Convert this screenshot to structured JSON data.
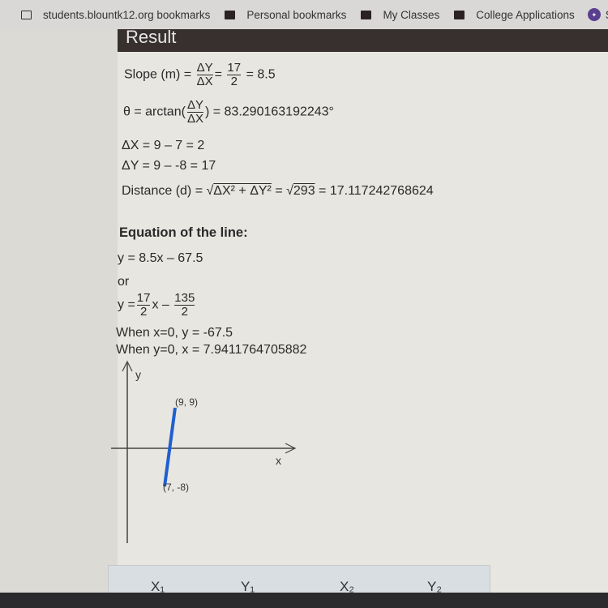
{
  "bookmarks": [
    {
      "label": "students.blountk12.org bookmarks",
      "icon": "bookmark-folder-icon"
    },
    {
      "label": "Personal bookmarks",
      "icon": "folder-icon"
    },
    {
      "label": "My Classes",
      "icon": "folder-icon"
    },
    {
      "label": "College Applications",
      "icon": "folder-icon"
    },
    {
      "label": "S",
      "icon": "extension-icon"
    }
  ],
  "result": {
    "title": "Result",
    "slope_prefix": "Slope (m) =",
    "slope_dy": "ΔY",
    "slope_dx": "ΔX",
    "slope_num": "17",
    "slope_den": "2",
    "slope_value": "= 8.5",
    "theta_prefix": "θ = arctan(",
    "theta_suffix": ") = 83.290163192243°",
    "delta_x": "ΔX = 9 – 7 = 2",
    "delta_y": "ΔY = 9 – -8 = 17",
    "distance_prefix": "Distance (d) = √",
    "distance_radicand": "ΔX² + ΔY²",
    "distance_mid": " = √",
    "distance_radicand2": "293",
    "distance_value": " = 17.117242768624"
  },
  "equation": {
    "title": "Equation of the line:",
    "line1": "y = 8.5x – 67.5",
    "or": "or",
    "y_eq": "y =",
    "f1_num": "17",
    "f1_den": "2",
    "x": "x –",
    "f2_num": "135",
    "f2_den": "2",
    "when_x0": "When x=0, y = -67.5",
    "when_y0": "When y=0, x = 7.9411764705882"
  },
  "graph": {
    "y_label": "y",
    "x_label": "x",
    "p1_label": "(9, 9)",
    "p2_label": "(7, -8)",
    "line_color": "#1f5fd0"
  },
  "table": {
    "headers": [
      "X₁",
      "Y₁",
      "X₂",
      "Y₂"
    ]
  }
}
